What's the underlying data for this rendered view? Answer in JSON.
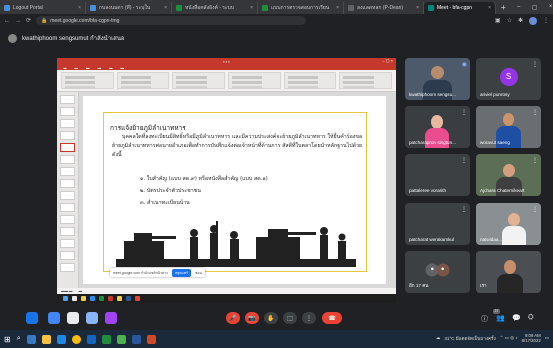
{
  "browser": {
    "tabs": [
      {
        "label": "Logout Portal",
        "color": "#4a90d9"
      },
      {
        "label": "กบลงนมดา (ที่) - ระบุใน",
        "color": "#4a90d9"
      },
      {
        "label": "หนังสือคลังอิงค์ - ระบบ",
        "color": "#1e8e3e"
      },
      {
        "label": "แบบการตรวจสอบการเรียน",
        "color": "#1e8e3e"
      },
      {
        "label": "ลงแลดหลก (P-Dean)",
        "color": "#5f6368"
      },
      {
        "label": "Meet - bfa-cgpn",
        "color": "#00897b",
        "active": true
      }
    ],
    "url": "meet.google.com/bfa-cgpn-tmg"
  },
  "presenter": {
    "name": "kwathiphoom sengsumut กำลังนำเสนอ"
  },
  "slide": {
    "title": "การแจ้งย้ายภูมิลำเนาทหาร",
    "paragraph": "บุคคลใดที่ลงทะเบียนมีสิทธิ์หรือมีภูมิลำเนาทหาร และมีความประสงค์จะย้ายภูมิลำเนาทหาร ให้ยื่นคำร้องขอย้ายภูมิลำเนาทหารต่อนายอำเภอเพื่อทำการบันทึกแจ้งต่อเจ้าหน้าที่ด้านการ สัสดีที่ใบตลาโดยนำหลักฐานไปด้วยดังนี้",
    "list": [
      "๑. ใบสำคัญ (แบบ สด.๙) หรือหนังสือสำคัญ (แบบ สด.๑)",
      "๒. บัตรประจำตัวประชาชน",
      "๓. สำเนาทะเบียนบ้าน"
    ]
  },
  "share_banner": {
    "text": "meet.google.com กำลังแชร์หน้าต่าง",
    "stop_label": "หยุดแชร์",
    "hide_label": "ซ่อน"
  },
  "participants": [
    {
      "name": "kwathiphoom sengsu...",
      "kind": "photo"
    },
    {
      "name": "ariviel punrosy",
      "kind": "initial",
      "initial": "S",
      "color": "#9334e6"
    },
    {
      "name": "patcharapron singtun...",
      "kind": "photo"
    },
    {
      "name": "woravut saeng",
      "kind": "photo"
    },
    {
      "name": "pattaleree vorarith",
      "kind": "none"
    },
    {
      "name": "Ajchara Chaternikeart",
      "kind": "photo"
    },
    {
      "name": "patcharat werakamkul",
      "kind": "none"
    },
    {
      "name": "natwidaa...",
      "kind": "photo"
    },
    {
      "name": "อีก 17 คน",
      "kind": "more"
    },
    {
      "name": "เรา",
      "kind": "self"
    }
  ],
  "meet_controls": {
    "mic": "🎤",
    "cam": "📷",
    "hand": "✋",
    "present": "⬚",
    "more": "⋮",
    "end": "☎"
  },
  "people_count": "27",
  "taskbar": {
    "weather": "31°C มีแดดจัดเป็นบางครั้ง",
    "time": "9:09 AM",
    "date": "8/17/2022"
  }
}
